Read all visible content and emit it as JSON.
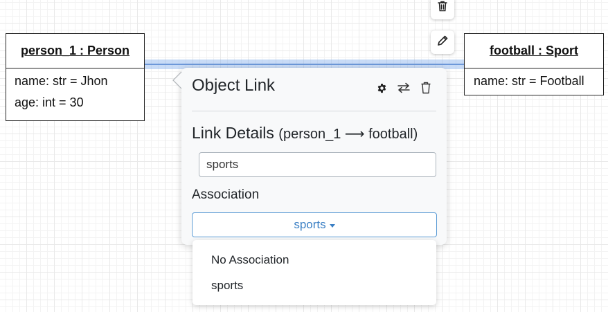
{
  "objects": {
    "person": {
      "title": "person_1 : Person",
      "attributes": [
        "name: str = Jhon",
        "age: int = 30"
      ]
    },
    "football": {
      "title": "football : Sport",
      "attributes": [
        "name: str = Football"
      ]
    }
  },
  "popover": {
    "title": "Object Link",
    "icons": [
      "gear-icon",
      "swap-icon",
      "trash-icon"
    ],
    "subtitle_main": "Link Details ",
    "subtitle_detail": "(person_1 ⟶ football)",
    "name_value": "sports",
    "association_label": "Association",
    "association_selected": "sports"
  },
  "dropdown": {
    "options": [
      "No Association",
      "sports"
    ]
  },
  "colors": {
    "link_highlight": "#86b0ec",
    "select_accent": "#3a7fc4"
  }
}
